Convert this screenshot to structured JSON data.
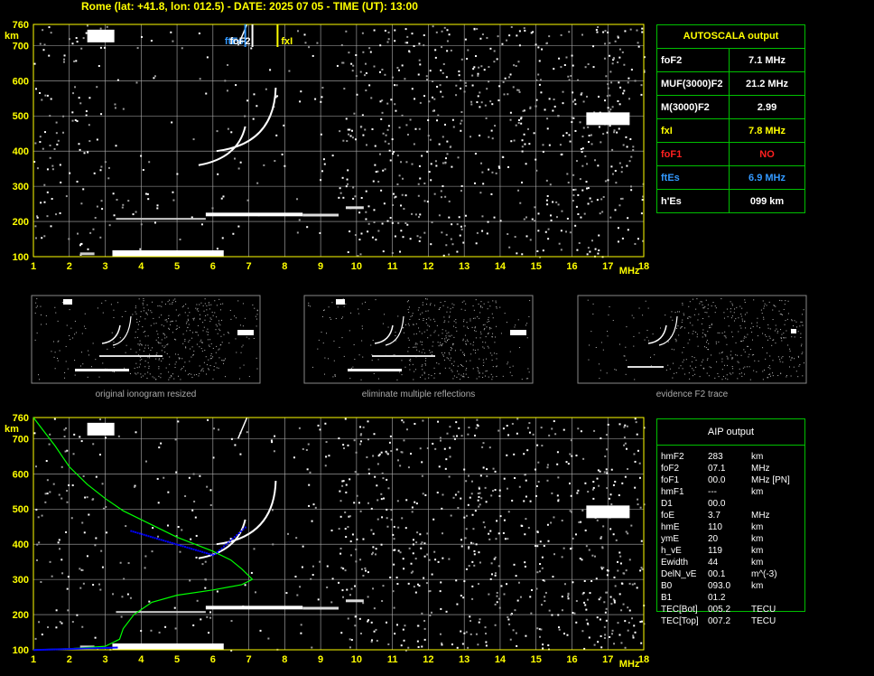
{
  "header": {
    "title": "Rome (lat: +41.8, lon: 012.5) - DATE: 2025 07 05 - TIME (UT): 13:00"
  },
  "colors": {
    "grid": "#b0b0b0",
    "frame": "#ffff00",
    "table_border": "#00c000",
    "trace": "#ffffff",
    "profile": "#00ff00",
    "true_height": "#0000ff",
    "fxI": "#ffff00",
    "foF2": "#ffffff",
    "ftEs": "#3399ff",
    "foF1": "#ff2020"
  },
  "chart_data": [
    {
      "type": "scatter",
      "name": "top-ionogram",
      "x_ticks": [
        "1",
        "2",
        "3",
        "4",
        "5",
        "6",
        "7",
        "8",
        "9",
        "10",
        "11",
        "12",
        "13",
        "14",
        "15",
        "16",
        "17",
        "18"
      ],
      "x_unit": "MHz",
      "y_ticks": [
        "100",
        "200",
        "300",
        "400",
        "500",
        "600",
        "700",
        "760"
      ],
      "y_unit": "km",
      "xlim": [
        1,
        18
      ],
      "ylim": [
        100,
        760
      ],
      "grid": true,
      "markers": [
        {
          "label": "ftEs",
          "x": 6.9,
          "color": "#3399ff"
        },
        {
          "label": "foF2",
          "x": 7.1,
          "color": "#ffffff"
        },
        {
          "label": "fxI",
          "x": 7.8,
          "color": "#ffff00"
        }
      ]
    },
    {
      "type": "line",
      "name": "bottom-ionogram-profile",
      "x_ticks": [
        "1",
        "2",
        "3",
        "4",
        "5",
        "6",
        "7",
        "8",
        "9",
        "10",
        "11",
        "12",
        "13",
        "14",
        "15",
        "16",
        "17",
        "18"
      ],
      "x_unit": "MHz",
      "y_ticks": [
        "100",
        "200",
        "300",
        "400",
        "500",
        "600",
        "700",
        "760"
      ],
      "y_unit": "km",
      "xlim": [
        1,
        18
      ],
      "ylim": [
        100,
        760
      ],
      "grid": true,
      "profile": [
        [
          1.0,
          760
        ],
        [
          1.3,
          720
        ],
        [
          1.6,
          680
        ],
        [
          2.0,
          620
        ],
        [
          2.5,
          570
        ],
        [
          3.0,
          530
        ],
        [
          3.5,
          495
        ],
        [
          4.0,
          470
        ],
        [
          4.5,
          445
        ],
        [
          5.0,
          420
        ],
        [
          5.5,
          400
        ],
        [
          6.0,
          380
        ],
        [
          6.5,
          355
        ],
        [
          6.8,
          330
        ],
        [
          7.1,
          300
        ],
        [
          6.8,
          285
        ],
        [
          6.0,
          270
        ],
        [
          5.0,
          255
        ],
        [
          4.3,
          235
        ],
        [
          3.8,
          200
        ],
        [
          3.5,
          160
        ],
        [
          3.4,
          130
        ],
        [
          3.0,
          110
        ],
        [
          2.0,
          103
        ],
        [
          1.0,
          100
        ]
      ]
    }
  ],
  "thumbnails": [
    {
      "caption": "original ionogram resized"
    },
    {
      "caption": "eliminate multiple reflections"
    },
    {
      "caption": "evidence F2 trace"
    }
  ],
  "autoscala": {
    "title": "AUTOSCALA output",
    "rows": [
      {
        "key": "foF2",
        "value": "7.1 MHz",
        "key_color": "#ffffff",
        "value_color": "#ffffff"
      },
      {
        "key": "MUF(3000)F2",
        "value": "21.2 MHz",
        "key_color": "#ffffff",
        "value_color": "#ffffff"
      },
      {
        "key": "M(3000)F2",
        "value": "2.99",
        "key_color": "#ffffff",
        "value_color": "#ffffff"
      },
      {
        "key": "fxI",
        "value": "7.8 MHz",
        "key_color": "#ffff00",
        "value_color": "#ffff00"
      },
      {
        "key": "foF1",
        "value": "NO",
        "key_color": "#ff2020",
        "value_color": "#ff2020"
      },
      {
        "key": "ftEs",
        "value": "6.9 MHz",
        "key_color": "#3399ff",
        "value_color": "#3399ff"
      },
      {
        "key": "h'Es",
        "value": "099     km",
        "key_color": "#ffffff",
        "value_color": "#ffffff"
      }
    ]
  },
  "aip": {
    "title": "AIP output",
    "rows": [
      {
        "name": "hmF2",
        "value": "283",
        "unit": "km"
      },
      {
        "name": "foF2",
        "value": "07.1",
        "unit": "MHz"
      },
      {
        "name": "foF1",
        "value": "00.0",
        "unit": "MHz    [PN]"
      },
      {
        "name": "hmF1",
        "value": "---",
        "unit": "km"
      },
      {
        "name": "D1",
        "value": "00.0",
        "unit": ""
      },
      {
        "name": "foE",
        "value": "3.7",
        "unit": "MHz"
      },
      {
        "name": "hmE",
        "value": "110",
        "unit": "km"
      },
      {
        "name": "ymE",
        "value": "20",
        "unit": "km"
      },
      {
        "name": "h_vE",
        "value": "119",
        "unit": "km"
      },
      {
        "name": "Ewidth",
        "value": "44",
        "unit": "km"
      },
      {
        "name": "DelN_vE",
        "value": "00.1",
        "unit": "m^(-3)"
      },
      {
        "name": "B0",
        "value": "093.0",
        "unit": "km"
      },
      {
        "name": "B1",
        "value": "01.2",
        "unit": ""
      },
      {
        "name": "TEC[Bot]",
        "value": "005.2",
        "unit": "TECU"
      },
      {
        "name": "TEC[Top]",
        "value": "007.2",
        "unit": "TECU"
      }
    ]
  }
}
